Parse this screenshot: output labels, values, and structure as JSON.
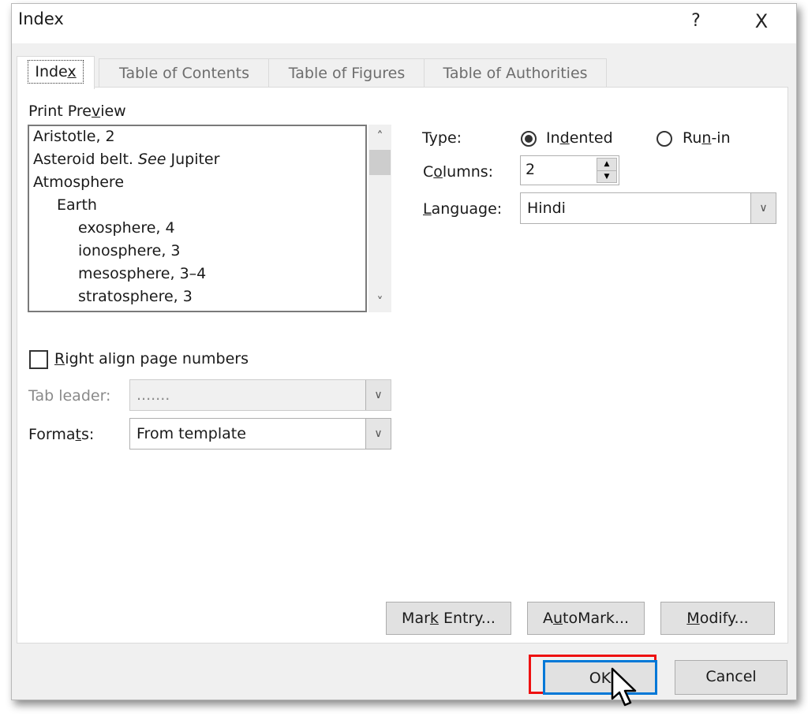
{
  "dialog": {
    "title": "Index",
    "help_label": "?",
    "close_label": "X"
  },
  "tabs": [
    {
      "label": "Index",
      "active": true
    },
    {
      "label": "Table of Contents",
      "active": false
    },
    {
      "label": "Table of Figures",
      "active": false
    },
    {
      "label": "Table of Authorities",
      "active": false
    }
  ],
  "print_preview": {
    "label": "Print Preview",
    "lines": [
      {
        "text": "Aristotle, 2",
        "level": 0
      },
      {
        "text_before": "Asteroid belt. ",
        "italic": "See",
        "text_after": " Jupiter",
        "level": 0
      },
      {
        "text": "Atmosphere",
        "level": 0
      },
      {
        "text": "Earth",
        "level": 1
      },
      {
        "text": "exosphere, 4",
        "level": 2
      },
      {
        "text": "ionosphere, 3",
        "level": 2
      },
      {
        "text": "mesosphere, 3–4",
        "level": 2
      },
      {
        "text": "stratosphere, 3",
        "level": 2
      }
    ],
    "scroll_up_icon": "^",
    "scroll_down_icon": "v"
  },
  "type": {
    "label": "Type:",
    "options": [
      {
        "label": "Indented",
        "selected": true
      },
      {
        "label": "Run-in",
        "selected": false
      }
    ]
  },
  "columns": {
    "label": "Columns:",
    "value": "2"
  },
  "language": {
    "label": "Language:",
    "value": "Hindi"
  },
  "right_align": {
    "label": "Right align page numbers",
    "checked": false
  },
  "tab_leader": {
    "label": "Tab leader:",
    "value": ".......",
    "disabled": true
  },
  "formats": {
    "label": "Formats:",
    "value": "From template"
  },
  "buttons": {
    "mark_entry": "Mark Entry...",
    "automark": "AutoMark...",
    "modify": "Modify...",
    "ok": "OK",
    "cancel": "Cancel"
  }
}
